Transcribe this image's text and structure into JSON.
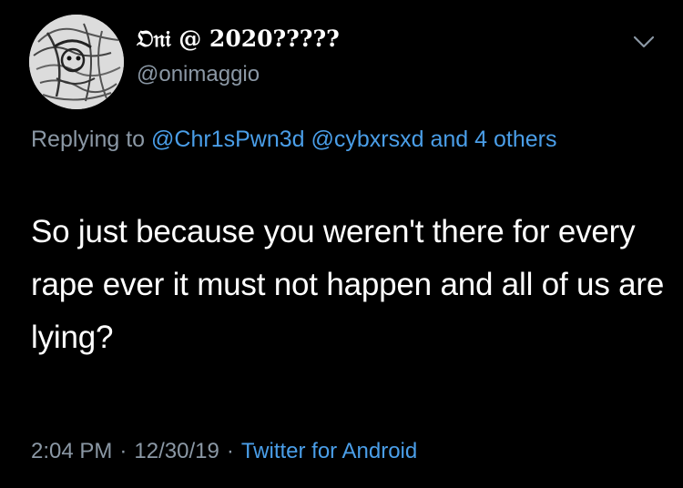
{
  "user": {
    "display_name": "𝔒𝔫𝔦 @ 2020?????",
    "handle": "@onimaggio"
  },
  "reply": {
    "prefix": "Replying to",
    "mentions": [
      "@Chr1sPwn3d",
      "@cybxrsxd"
    ],
    "conjunction": "and",
    "others_link": "4 others"
  },
  "tweet": {
    "text": "So just because you weren't there for every rape ever it must not happen and all of us are lying?"
  },
  "meta": {
    "time": "2:04 PM",
    "date": "12/30/19",
    "separator": "·",
    "source": "Twitter for Android"
  },
  "icons": {
    "avatar": "profile-avatar",
    "more": "chevron-down-icon"
  },
  "colors": {
    "background": "#000000",
    "text_primary": "#ffffff",
    "text_secondary": "#8b98a5",
    "link": "#4a9ee8"
  }
}
